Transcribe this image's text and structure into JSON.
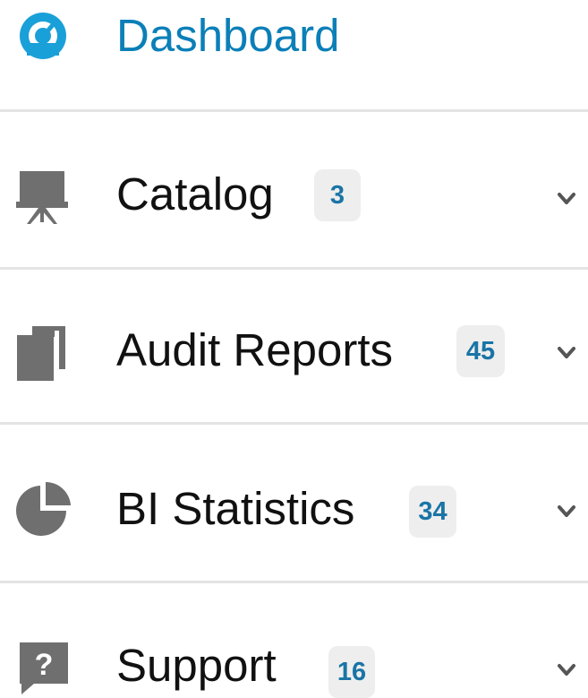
{
  "nav": {
    "items": [
      {
        "id": "dashboard",
        "label": "Dashboard",
        "icon": "dashboard-gauge-icon",
        "active": true,
        "badge": null,
        "expandable": false
      },
      {
        "id": "catalog",
        "label": "Catalog",
        "icon": "presentation-board-icon",
        "active": false,
        "badge": "3",
        "expandable": true
      },
      {
        "id": "audit-reports",
        "label": "Audit Reports",
        "icon": "copy-documents-icon",
        "active": false,
        "badge": "45",
        "expandable": true
      },
      {
        "id": "bi-statistics",
        "label": "BI Statistics",
        "icon": "pie-chart-icon",
        "active": false,
        "badge": "34",
        "expandable": true
      },
      {
        "id": "support",
        "label": "Support",
        "icon": "help-chat-icon",
        "active": false,
        "badge": "16",
        "expandable": true
      }
    ]
  },
  "colors": {
    "accent": "#1aa0d8",
    "active_text": "#0b7fb8",
    "badge_text": "#1a74a6",
    "badge_bg": "#eeeeee",
    "icon_gray": "#6f6f6f",
    "divider": "#e4e4e4"
  }
}
